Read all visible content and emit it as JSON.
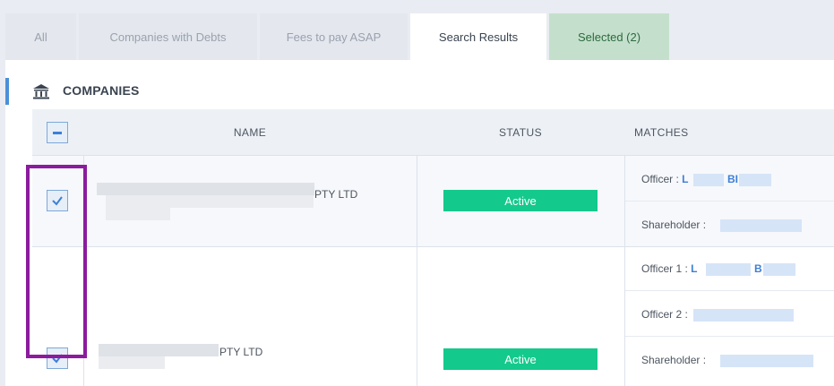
{
  "tabs": [
    {
      "label": "All"
    },
    {
      "label": "Companies with Debts"
    },
    {
      "label": "Fees to pay ASAP"
    },
    {
      "label": "Search Results"
    },
    {
      "label": "Selected (2)"
    }
  ],
  "section": {
    "title": "COMPANIES",
    "icon": "bank-icon"
  },
  "table": {
    "headers": {
      "name": "NAME",
      "status": "STATUS",
      "matches": "MATCHES"
    },
    "rows": [
      {
        "name_suffix": "PTY LTD",
        "status": "Active",
        "matches": [
          {
            "label": "Officer :",
            "hl1": "L",
            "hl2": "BI"
          },
          {
            "label": "Shareholder :"
          }
        ]
      },
      {
        "name_suffix": "PTY LTD",
        "status": "Active",
        "matches": [
          {
            "label": "Officer 1 :",
            "hl1": "L",
            "hl2": "B"
          },
          {
            "label": "Officer 2 :"
          },
          {
            "label": "Shareholder :"
          }
        ]
      }
    ]
  },
  "colors": {
    "accent": "#4a90d9",
    "status_active": "#14c98c",
    "selected_tab": "#c4e0cc",
    "highlight": "#8c1b9e"
  }
}
